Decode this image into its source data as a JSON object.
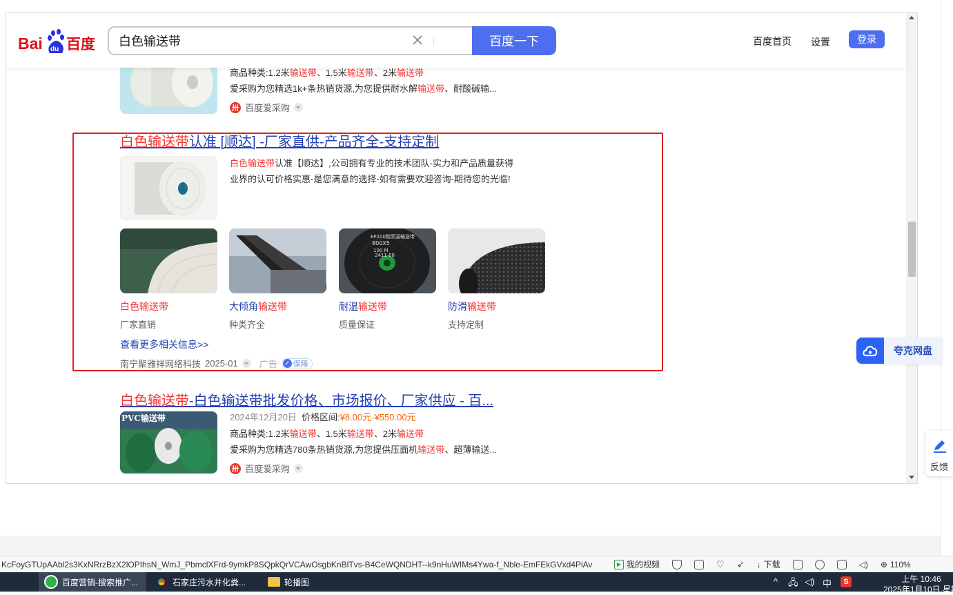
{
  "search": {
    "query": "白色输送带",
    "button_label": "百度一下"
  },
  "header": {
    "logo_text_bai": "Bai",
    "logo_text_du": "du",
    "logo_text_cn": "百度",
    "home_link": "百度首页",
    "settings_link": "设置",
    "login_button": "登录"
  },
  "result_top": {
    "snippet_line1_prefix": "商品种类:1.2米",
    "kw": "输送带",
    "snippet_line1_mid1": "、1.5米",
    "snippet_line1_mid2": "、2米",
    "snippet_line2_prefix": "爱采购为您精选1k+条热销货源,为您提供耐水解",
    "snippet_line2_suffix": "、耐酸碱输...",
    "source": "百度爱采购"
  },
  "ad_result": {
    "title_red": "白色输送带",
    "title_rest": "认准 [顺达] -厂家直供-产品齐全-支持定制",
    "desc_red": "白色输送带",
    "desc_line1": "认准【顺达】,公司拥有专业的技术团队-实力和产品质量获得",
    "desc_line2": "业界的认可价格实惠-是您满意的选择-如有需要欢迎咨询-期待您的光临!",
    "products": [
      {
        "name_prefix": "",
        "name_kw": "白色输送带",
        "sub": "厂家直销"
      },
      {
        "name_prefix": "大倾角",
        "name_kw": "输送带",
        "sub": "种类齐全"
      },
      {
        "name_prefix": "耐温",
        "name_kw": "输送带",
        "sub": "质量保证"
      },
      {
        "name_prefix": "防滑",
        "name_kw": "输送带",
        "sub": "支持定制"
      }
    ],
    "product_image_labels": [
      "EP200耐高温输送带",
      "800X5",
      "100 M",
      "2411 68"
    ],
    "more_link": "查看更多相关信息>>",
    "advertiser": "南宁聚雅祥网络科技",
    "date": "2025-01",
    "ad_label": "广告",
    "guarantee_label": "保障"
  },
  "result_bottom": {
    "title_red": "白色输送带",
    "title_rest": "-白色输送带批发价格、市场报价、厂家供应 - 百...",
    "image_tag": "PVC输送带",
    "date": "2024年12月20日",
    "price_label": "价格区间:",
    "price_range": "¥8.00元-¥550.00元",
    "snippet_line1_prefix": "商品种类:1.2米",
    "kw": "输送带",
    "snippet_line1_mid1": "、1.5米",
    "snippet_line1_mid2": "、2米",
    "snippet_line2_prefix": "爱采购为您精选780条热销货源,为您提供压面机",
    "snippet_line2_suffix": "、超薄输送...",
    "source": "百度爱采购"
  },
  "widgets": {
    "quark_label": "夸克网盘",
    "feedback_label": "反馈"
  },
  "status_bar": {
    "url": "KcFoyGTUpAAbl2s3KxNRrzBzX2lOPIhsN_WmJ_PbmclXFrd-9ymkP8SQpkQrVCAwOsgbKnBlTvs-B4CeWQNDHT--k9nHuWIMs4Ywa-f_Nble-EmFEkGVxd4PiAv",
    "my_video": "我的视频",
    "download": "下载",
    "zoom": "110%"
  },
  "taskbar": {
    "tasks": [
      "百度营销-搜索推广...",
      "石家庄污水井化粪...",
      "轮播图"
    ],
    "ime": "中",
    "time": "上午 10:46",
    "date_partial": "2025年1月10日 星期"
  },
  "colors": {
    "brand_blue": "#4e6ef2",
    "keyword_red": "#f73131",
    "link_blue": "#2440b3",
    "price_orange": "#ff6600",
    "highlight_box": "#e02020"
  }
}
